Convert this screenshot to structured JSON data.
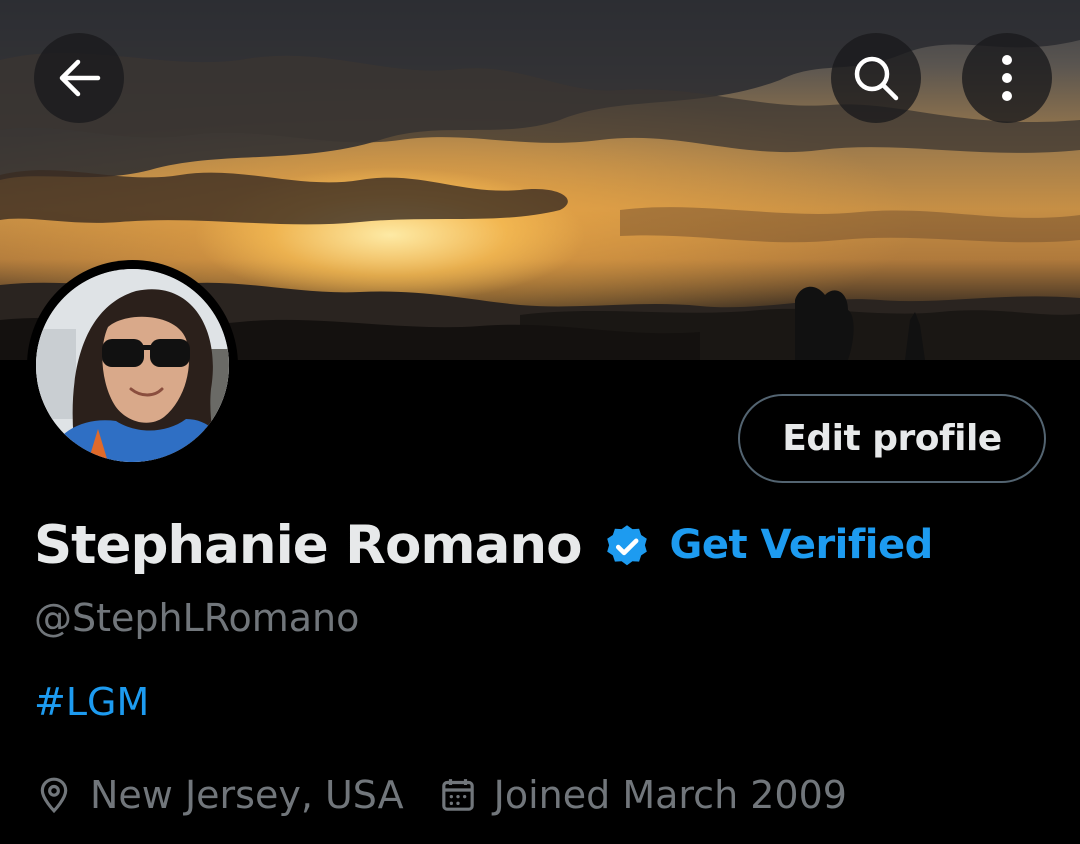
{
  "header": {
    "back_icon": "arrow-left-icon",
    "search_icon": "search-icon",
    "more_icon": "more-vertical-icon"
  },
  "profile": {
    "display_name": "Stephanie Romano",
    "verified_badge_icon": "verified-badge-icon",
    "get_verified_label": "Get Verified",
    "handle": "@StephLRomano",
    "bio": "#LGM",
    "location": "New Jersey, USA",
    "location_icon": "location-pin-icon",
    "joined": "Joined March 2009",
    "joined_icon": "calendar-icon",
    "edit_profile_label": "Edit profile"
  },
  "colors": {
    "background": "#000000",
    "accent": "#1d9bf0",
    "primary_text": "#e7e9ea",
    "secondary_text": "#71767b",
    "button_border": "#536471"
  }
}
